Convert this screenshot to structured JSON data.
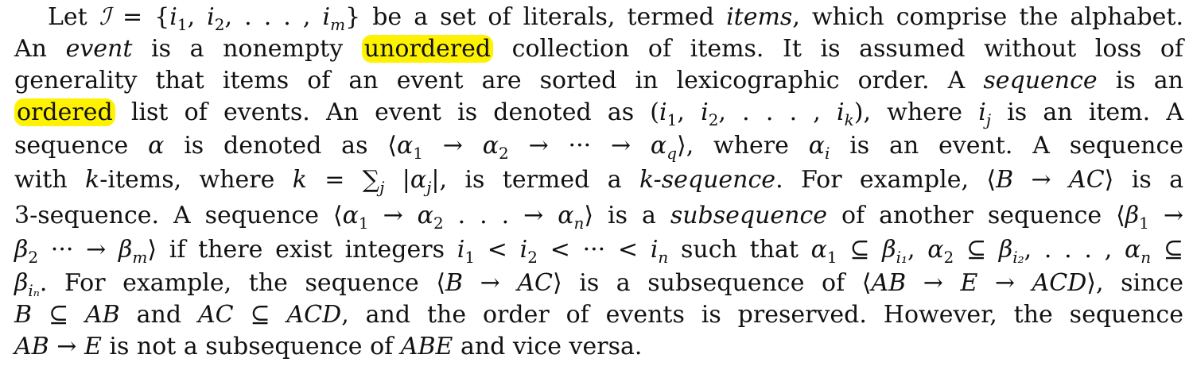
{
  "highlight_color": "#fff200",
  "paragraph": {
    "lines": [
      {
        "id": "l1",
        "segments": [
          {
            "t": "Let "
          },
          {
            "t": "ℐ",
            "i": true
          },
          {
            "t": " = {"
          },
          {
            "t": "i",
            "i": true
          },
          {
            "t": "1",
            "sub": true
          },
          {
            "t": ", "
          },
          {
            "t": "i",
            "i": true
          },
          {
            "t": "2",
            "sub": true
          },
          {
            "t": ", . . . , "
          },
          {
            "t": "i",
            "i": true
          },
          {
            "t": "m",
            "sub": true,
            "i": true
          },
          {
            "t": "} be a set of literals, termed "
          },
          {
            "t": "items",
            "i": true
          },
          {
            "t": ", which comprise the alphabet."
          }
        ]
      },
      {
        "id": "l2",
        "segments": [
          {
            "t": "An "
          },
          {
            "t": "event",
            "i": true
          },
          {
            "t": " is a nonempty "
          },
          {
            "t": "unordered",
            "hl": true
          },
          {
            "t": " collection of items. It is assumed without loss of"
          }
        ]
      },
      {
        "id": "l3",
        "segments": [
          {
            "t": "generality that items of an event are sorted in lexicographic order. A "
          },
          {
            "t": "sequence",
            "i": true
          },
          {
            "t": " is an"
          }
        ]
      },
      {
        "id": "l4",
        "segments": [
          {
            "t": "ordered",
            "hl": true
          },
          {
            "t": " list of events. An event is denoted as ("
          },
          {
            "t": "i",
            "i": true
          },
          {
            "t": "1",
            "sub": true
          },
          {
            "t": ", "
          },
          {
            "t": "i",
            "i": true
          },
          {
            "t": "2",
            "sub": true
          },
          {
            "t": ", . . . , "
          },
          {
            "t": "i",
            "i": true
          },
          {
            "t": "k",
            "sub": true,
            "i": true
          },
          {
            "t": "), where "
          },
          {
            "t": "i",
            "i": true
          },
          {
            "t": "j",
            "sub": true,
            "i": true
          },
          {
            "t": " is an item. A"
          }
        ]
      },
      {
        "id": "l5",
        "segments": [
          {
            "t": "sequence "
          },
          {
            "t": "α",
            "i": true
          },
          {
            "t": " is denoted as ⟨"
          },
          {
            "t": "α",
            "i": true
          },
          {
            "t": "1",
            "sub": true
          },
          {
            "t": " → "
          },
          {
            "t": "α",
            "i": true
          },
          {
            "t": "2",
            "sub": true
          },
          {
            "t": " → ··· → "
          },
          {
            "t": "α",
            "i": true
          },
          {
            "t": "q",
            "sub": true,
            "i": true
          },
          {
            "t": "⟩, where "
          },
          {
            "t": "α",
            "i": true
          },
          {
            "t": "i",
            "sub": true,
            "i": true
          },
          {
            "t": " is an event. A sequence"
          }
        ]
      },
      {
        "id": "l6",
        "segments": [
          {
            "t": "with "
          },
          {
            "t": "k",
            "i": true
          },
          {
            "t": "-items, where "
          },
          {
            "t": "k",
            "i": true
          },
          {
            "t": " = ∑"
          },
          {
            "t": "j",
            "sub": true,
            "i": true
          },
          {
            "t": " |"
          },
          {
            "t": "α",
            "i": true
          },
          {
            "t": "j",
            "sub": true,
            "i": true
          },
          {
            "t": "|, is termed a "
          },
          {
            "t": "k-sequence",
            "i": true
          },
          {
            "t": ". For example, ⟨"
          },
          {
            "t": "B",
            "i": true
          },
          {
            "t": " → "
          },
          {
            "t": "AC",
            "i": true
          },
          {
            "t": "⟩ is a"
          }
        ]
      },
      {
        "id": "l7",
        "segments": [
          {
            "t": "3-sequence. A sequence ⟨"
          },
          {
            "t": "α",
            "i": true
          },
          {
            "t": "1",
            "sub": true
          },
          {
            "t": " → "
          },
          {
            "t": "α",
            "i": true
          },
          {
            "t": "2",
            "sub": true
          },
          {
            "t": " . . . → "
          },
          {
            "t": "α",
            "i": true
          },
          {
            "t": "n",
            "sub": true,
            "i": true
          },
          {
            "t": "⟩ is a "
          },
          {
            "t": "subsequence",
            "i": true
          },
          {
            "t": " of another sequence ⟨"
          },
          {
            "t": "β",
            "i": true
          },
          {
            "t": "1",
            "sub": true
          },
          {
            "t": " →"
          }
        ]
      },
      {
        "id": "l8",
        "segments": [
          {
            "t": "β",
            "i": true
          },
          {
            "t": "2",
            "sub": true
          },
          {
            "t": " ··· → "
          },
          {
            "t": "β",
            "i": true
          },
          {
            "t": "m",
            "sub": true,
            "i": true
          },
          {
            "t": "⟩ if there exist integers "
          },
          {
            "t": "i",
            "i": true
          },
          {
            "t": "1",
            "sub": true
          },
          {
            "t": " < "
          },
          {
            "t": "i",
            "i": true
          },
          {
            "t": "2",
            "sub": true
          },
          {
            "t": " < ··· < "
          },
          {
            "t": "i",
            "i": true
          },
          {
            "t": "n",
            "sub": true,
            "i": true
          },
          {
            "t": " such that "
          },
          {
            "t": "α",
            "i": true
          },
          {
            "t": "1",
            "sub": true
          },
          {
            "t": " ⊆ "
          },
          {
            "t": "β",
            "i": true
          },
          {
            "t": "i₁",
            "sub": true,
            "i": true
          },
          {
            "t": ", "
          },
          {
            "t": "α",
            "i": true
          },
          {
            "t": "2",
            "sub": true
          },
          {
            "t": " ⊆ "
          },
          {
            "t": "β",
            "i": true
          },
          {
            "t": "i₂",
            "sub": true,
            "i": true
          },
          {
            "t": ", . . . , "
          },
          {
            "t": "α",
            "i": true
          },
          {
            "t": "n",
            "sub": true,
            "i": true
          },
          {
            "t": " ⊆"
          }
        ]
      },
      {
        "id": "l9",
        "segments": [
          {
            "t": "β",
            "i": true
          },
          {
            "t": "iₙ",
            "sub": true,
            "i": true
          },
          {
            "t": ". For example, the sequence ⟨"
          },
          {
            "t": "B",
            "i": true
          },
          {
            "t": " → "
          },
          {
            "t": "AC",
            "i": true
          },
          {
            "t": "⟩ is a subsequence of ⟨"
          },
          {
            "t": "AB",
            "i": true
          },
          {
            "t": " → "
          },
          {
            "t": "E",
            "i": true
          },
          {
            "t": " → "
          },
          {
            "t": "ACD",
            "i": true
          },
          {
            "t": "⟩, since"
          }
        ]
      },
      {
        "id": "l10",
        "segments": [
          {
            "t": "B",
            "i": true
          },
          {
            "t": " ⊆ "
          },
          {
            "t": "AB",
            "i": true
          },
          {
            "t": " and "
          },
          {
            "t": "AC",
            "i": true
          },
          {
            "t": " ⊆ "
          },
          {
            "t": "ACD",
            "i": true
          },
          {
            "t": ", and the order of events is preserved. However, the sequence"
          }
        ]
      },
      {
        "id": "l11",
        "segments": [
          {
            "t": "AB",
            "i": true
          },
          {
            "t": " → "
          },
          {
            "t": "E",
            "i": true
          },
          {
            "t": " is not a subsequence of "
          },
          {
            "t": "ABE",
            "i": true
          },
          {
            "t": " and vice versa."
          }
        ]
      }
    ]
  }
}
